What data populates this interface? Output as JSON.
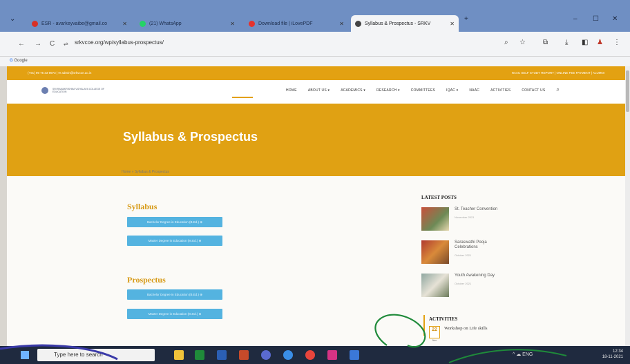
{
  "browser": {
    "tabs": [
      {
        "label": "ESR - avarkeyvaibe@gmail.co",
        "icon": "gmail-icon",
        "color": "#d93025"
      },
      {
        "label": "(21) WhatsApp",
        "icon": "whatsapp-icon",
        "color": "#25d366"
      },
      {
        "label": "Download file | iLovePDF",
        "icon": "ilovepdf-icon",
        "color": "#e5322d"
      },
      {
        "label": "Syllabus & Prospectus - SRKV",
        "icon": "site-icon",
        "color": "#444444"
      }
    ],
    "new_tab": "+",
    "window": {
      "minimize": "–",
      "maximize": "☐",
      "close": "✕"
    },
    "url": "srkvcoe.org/wp/syllabus-prospectus/",
    "bookmark": "Google"
  },
  "site": {
    "topstrip_left": "(+91) 99 75 33 9973  |  ✉ admin@srkvcoe.ac.in",
    "topstrip_right": "NAAC SELF STUDY REPORT  |  ONLINE FEE PAYMENT  |  ALUMNI",
    "logo_text": "SRI RAMAKRISHNA VIDYALAYA COLLEGE OF EDUCATION",
    "menu": [
      "HOME",
      "ABOUT US ▾",
      "ACADEMICS ▾",
      "RESEARCH ▾",
      "COMMITTEES",
      "IQAC ▾",
      "NAAC",
      "ACTIVITIES",
      "CONTACT US"
    ],
    "hero_title": "Syllabus & Prospectus",
    "breadcrumb": "Home  »  Syllabus & Prospectus",
    "syllabus": {
      "title": "Syllabus",
      "buttons": [
        "Bachelor Degree in Education (B.Ed.) ⊕",
        "Master Degree in Education (M.Ed.) ⊕"
      ]
    },
    "prospectus": {
      "title": "Prospectus",
      "buttons": [
        "Bachelor Degree in Education (B.Ed.) ⊕",
        "Master Degree in Education (M.Ed.) ⊕"
      ]
    },
    "sidebar": {
      "latest_heading": "LATEST POSTS",
      "posts": [
        {
          "title": "St. Teacher Convention",
          "date": "November 2021"
        },
        {
          "title": "Saraswathi Pooja Celebrations",
          "date": "October 2021"
        },
        {
          "title": "Youth Awakening Day",
          "date": "October 2021"
        }
      ],
      "activities_heading": "ACTIVITIES",
      "activity": {
        "day": "22",
        "month": "Nov",
        "title": "Workshop on Life skills"
      }
    }
  },
  "taskbar": {
    "search_placeholder": "Type here to search",
    "time": "12:34",
    "date": "18-11-2021",
    "tray_label": "ENG"
  },
  "colors": {
    "accent": "#e0a113",
    "button": "#54b3e0",
    "ink": "#1f8a3a"
  }
}
